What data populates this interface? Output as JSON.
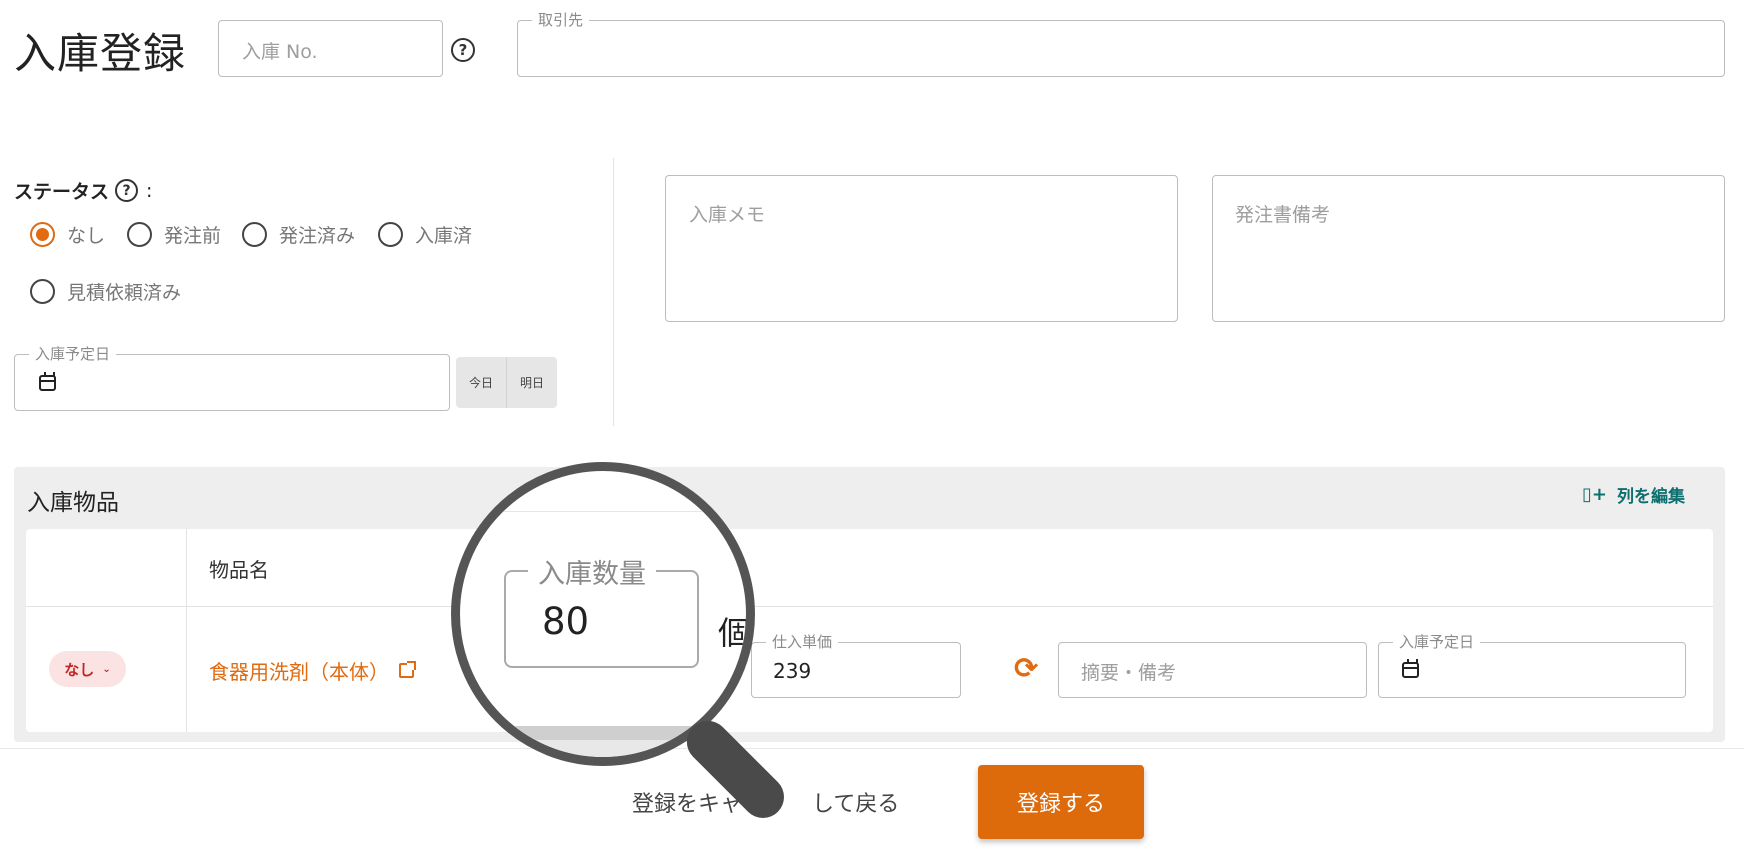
{
  "page": {
    "title": "入庫登録",
    "receipt_no_placeholder": "入庫 No.",
    "supplier_label": "取引先",
    "supplier_value": ""
  },
  "status": {
    "label": "ステータス",
    "colon": ":",
    "options": [
      "なし",
      "発注前",
      "発注済み",
      "入庫済",
      "見積依頼済み"
    ],
    "selected": "なし"
  },
  "scheduled_date": {
    "label": "入庫予定日",
    "value": "",
    "today_label": "今日",
    "tomorrow_label": "明日"
  },
  "memos": {
    "receipt_memo_placeholder": "入庫メモ",
    "po_notes_placeholder": "発注書備考"
  },
  "items": {
    "section_title": "入庫物品",
    "edit_columns_label": "列を編集",
    "columns": [
      "物品名",
      "入庫数量"
    ],
    "rows": [
      {
        "status_badge": "なし",
        "name": "食器用洗剤（本体）",
        "quantity": "80",
        "unit": "個",
        "unit_price_label": "仕入単価",
        "unit_price": "239",
        "remarks_placeholder": "摘要・備考",
        "date_label": "入庫予定日",
        "date_value": ""
      }
    ]
  },
  "footer": {
    "cancel_label": "登録をキャンセルして戻る",
    "cancel_visible": "登録をキャ",
    "cancel_visible_tail": "して戻る",
    "submit_label": "登録する"
  },
  "colors": {
    "accent": "#dd6a0b",
    "link": "#e06b10",
    "teal": "#0e6f6f",
    "badge_bg": "#fbe3e3",
    "badge_text": "#c02626"
  },
  "icons": [
    "help-icon",
    "calendar-icon",
    "column-add-icon",
    "external-link-icon",
    "sync-icon",
    "chevron-down-icon",
    "magnifier-icon"
  ]
}
